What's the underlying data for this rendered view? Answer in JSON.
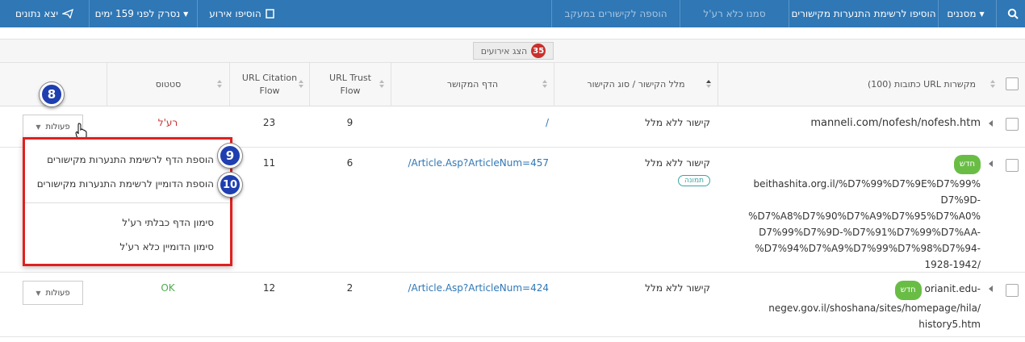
{
  "toolbar": {
    "search_icon": "search-icon",
    "filters": "מסננים",
    "add_to_tracking": "הוסיפו לרשימת התנערות מקישורים",
    "mark_all_bad": "סמנו כלא רע'ל",
    "add_to_tracked_links": "הוספה לקישורים במעקב",
    "add_event": "הוסיפו אירוע",
    "crawled": "נסרק לפני 159 ימים",
    "export": "יצא נתונים"
  },
  "events": {
    "label": "הצג אירועים",
    "count": "35"
  },
  "table": {
    "columns": {
      "urls": "(100) כתובות URL מקשרות",
      "anchor": "מלל הקישור / סוג הקישור",
      "linked_page": "הדף המקושר",
      "trust_flow": "URL Trust Flow",
      "citation_flow": "URL Citation Flow",
      "status": "סטטוס"
    },
    "rows": [
      {
        "url": "manneli.com/nofesh/nofesh.htm",
        "badge": "",
        "anchor": "קישור ללא מלל",
        "anchor_badge": "",
        "target": "/",
        "trust_flow": "9",
        "citation_flow": "23",
        "status": "רע'ל",
        "actions": "פעולות"
      },
      {
        "url_lines": [
          "beithashita.org.il/%D7%99%D7%9E%D7%99%",
          "D7%9D-",
          "%D7%A8%D7%90%D7%A9%D7%95%D7%A0%",
          "D7%99%D7%9D-%D7%91%D7%99%D7%AA-",
          "%D7%94%D7%A9%D7%99%D7%98%D7%94-",
          "1928-1942/"
        ],
        "badge": "חדש",
        "anchor": "קישור ללא מלל",
        "anchor_badge": "תמונה",
        "target": "/Article.Asp?ArticleNum=457",
        "trust_flow": "6",
        "citation_flow": "11",
        "status": "",
        "actions": "פעולות"
      },
      {
        "url_lines": [
          "orianit.edu-",
          "negev.gov.il/shoshana/sites/homepage/hila/",
          "history5.htm"
        ],
        "badge": "חדש",
        "anchor": "קישור ללא מלל",
        "anchor_badge": "",
        "target": "/Article.Asp?ArticleNum=424",
        "trust_flow": "2",
        "citation_flow": "12",
        "status": "OK",
        "actions": "פעולות"
      }
    ]
  },
  "menu": {
    "add_page": "הוספת הדף לרשימת התנערות מקישורים",
    "add_domain": "הוספת הדומיין לרשימת התנערות מקישורים",
    "mark_page_ok": "סימון הדף כבלתי רע'ל",
    "mark_domain_ok": "סימון הדומיין כלא רע'ל"
  },
  "steps": {
    "s8": "8",
    "s9": "9",
    "s10": "10"
  },
  "colors": {
    "toolbar": "#2f77b5",
    "highlight": "#e02020",
    "step": "#1f3fb0",
    "new_badge": "#69bd45"
  }
}
